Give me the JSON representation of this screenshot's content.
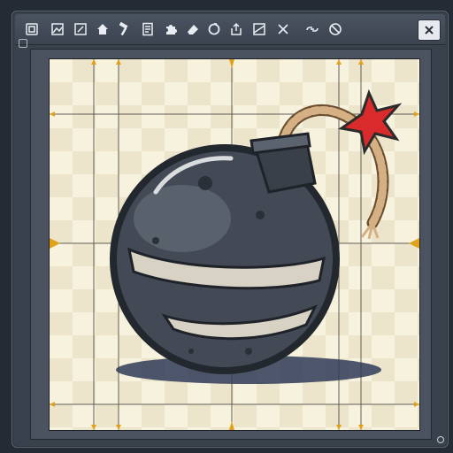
{
  "toolbar": {
    "tools": [
      {
        "icon": "select-frame-icon"
      },
      {
        "icon": "image-icon"
      },
      {
        "icon": "edit-image-icon"
      },
      {
        "icon": "home-icon"
      },
      {
        "icon": "hammer-icon"
      },
      {
        "icon": "document-icon"
      },
      {
        "icon": "puzzle-icon"
      },
      {
        "icon": "eraser-icon"
      },
      {
        "icon": "refresh-icon"
      },
      {
        "icon": "export-icon"
      },
      {
        "icon": "crop-icon"
      },
      {
        "icon": "close-x-icon"
      },
      {
        "icon": "link-icon"
      },
      {
        "icon": "no-entry-icon"
      }
    ],
    "close_icon": "close-window-icon"
  },
  "canvas": {
    "subject": "bomb-illustration",
    "colors": {
      "background": "#f7f2dd",
      "checker": "#ece5cb",
      "guide": "#3b3b3b",
      "marker": "#e0a21b",
      "bomb_body": "#3f4650",
      "bomb_highlight": "#d8d2c4",
      "spark": "#d92b2b",
      "rope": "#c8a57a"
    }
  }
}
